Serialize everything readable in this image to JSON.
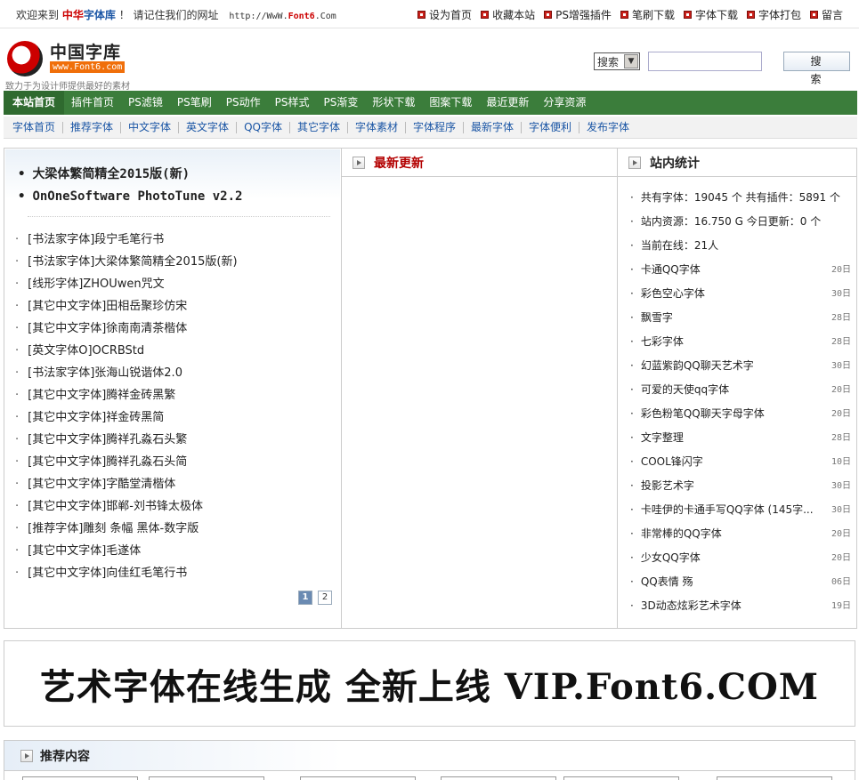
{
  "topbar": {
    "welcome_prefix": "欢迎来到",
    "brand_a": "中华",
    "brand_b": "字体库",
    "welcome_suffix": "！ 请记住我们的网址",
    "url_prefix": "http://WwW.",
    "url_domain": "Font6",
    "url_suffix": ".Com",
    "links": [
      "设为首页",
      "收藏本站",
      "PS增强插件",
      "笔刷下载",
      "字体下载",
      "字体打包",
      "留言"
    ]
  },
  "header": {
    "logo_title": "中国字库",
    "logo_sub": "www.Font6.com",
    "slogan": "致力于为设计师提供最好的素材",
    "search_select": "搜索",
    "search_value": "",
    "search_button": "搜 索"
  },
  "mainnav": [
    "本站首页",
    "插件首页",
    "PS滤镜",
    "PS笔刷",
    "PS动作",
    "PS样式",
    "PS渐变",
    "形状下载",
    "图案下载",
    "最近更新",
    "分享资源"
  ],
  "subnav": [
    "字体首页",
    "推荐字体",
    "中文字体",
    "英文字体",
    "QQ字体",
    "其它字体",
    "字体素材",
    "字体程序",
    "最新字体",
    "字体便利",
    "发布字体"
  ],
  "left": {
    "featured": [
      "大梁体繁简精全2015版(新)",
      "OnOneSoftware PhotoTune v2.2"
    ],
    "fonts": [
      "[书法家字体]段宁毛笔行书",
      "[书法家字体]大梁体繁简精全2015版(新)",
      "[线形字体]ZHOUwen咒文",
      "[其它中文字体]田相岳聚珍仿宋",
      "[其它中文字体]徐南南清茶楷体",
      "[英文字体O]OCRBStd",
      "[书法家字体]张海山锐谐体2.0",
      "[其它中文字体]腾祥金砖黑繁",
      "[其它中文字体]祥金砖黑简",
      "[其它中文字体]腾祥孔淼石头繁",
      "[其它中文字体]腾祥孔淼石头简",
      "[其它中文字体]字酷堂清楷体",
      "[其它中文字体]邯郸-刘书锋太极体",
      "[推荐字体]雕刻 条幅 黑体-数字版",
      "[其它中文字体]毛遂体",
      "[其它中文字体]向佳红毛笔行书"
    ],
    "pager": [
      "1",
      "2"
    ]
  },
  "middle": {
    "title": "最新更新"
  },
  "right": {
    "title": "站内统计",
    "stats_line1": "共有字体：19045 个  共有插件：5891 个",
    "stats_line2": "站内资源：16.750 G  今日更新：0 个",
    "stats_line3": "当前在线：21人",
    "items": [
      {
        "name": "卡通QQ字体",
        "date": "20日"
      },
      {
        "name": "彩色空心字体",
        "date": "30日"
      },
      {
        "name": "飘雪字",
        "date": "28日"
      },
      {
        "name": "七彩字体",
        "date": "28日"
      },
      {
        "name": "幻蓝紫韵QQ聊天艺术字",
        "date": "30日"
      },
      {
        "name": "可爱的天使qq字体",
        "date": "20日"
      },
      {
        "name": "彩色粉笔QQ聊天字母字体",
        "date": "20日"
      },
      {
        "name": "文字整理",
        "date": "28日"
      },
      {
        "name": "COOL锋闪字",
        "date": "10日"
      },
      {
        "name": "投影艺术字",
        "date": "30日"
      },
      {
        "name": "卡哇伊的卡通手写QQ字体 (145字...",
        "date": "30日"
      },
      {
        "name": "非常棒的QQ字体",
        "date": "20日"
      },
      {
        "name": "少女QQ字体",
        "date": "20日"
      },
      {
        "name": "QQ表情 殇",
        "date": "06日"
      },
      {
        "name": "3D动态炫彩艺术字体",
        "date": "19日"
      }
    ]
  },
  "banner": {
    "text": "艺术字体在线生成 全新上线 VIP.Font6.COM"
  },
  "recommend": {
    "title": "推荐内容"
  },
  "colors": {
    "nav_green": "#3b7d3b",
    "link_blue": "#1b56a5",
    "accent_red": "#b30000"
  }
}
